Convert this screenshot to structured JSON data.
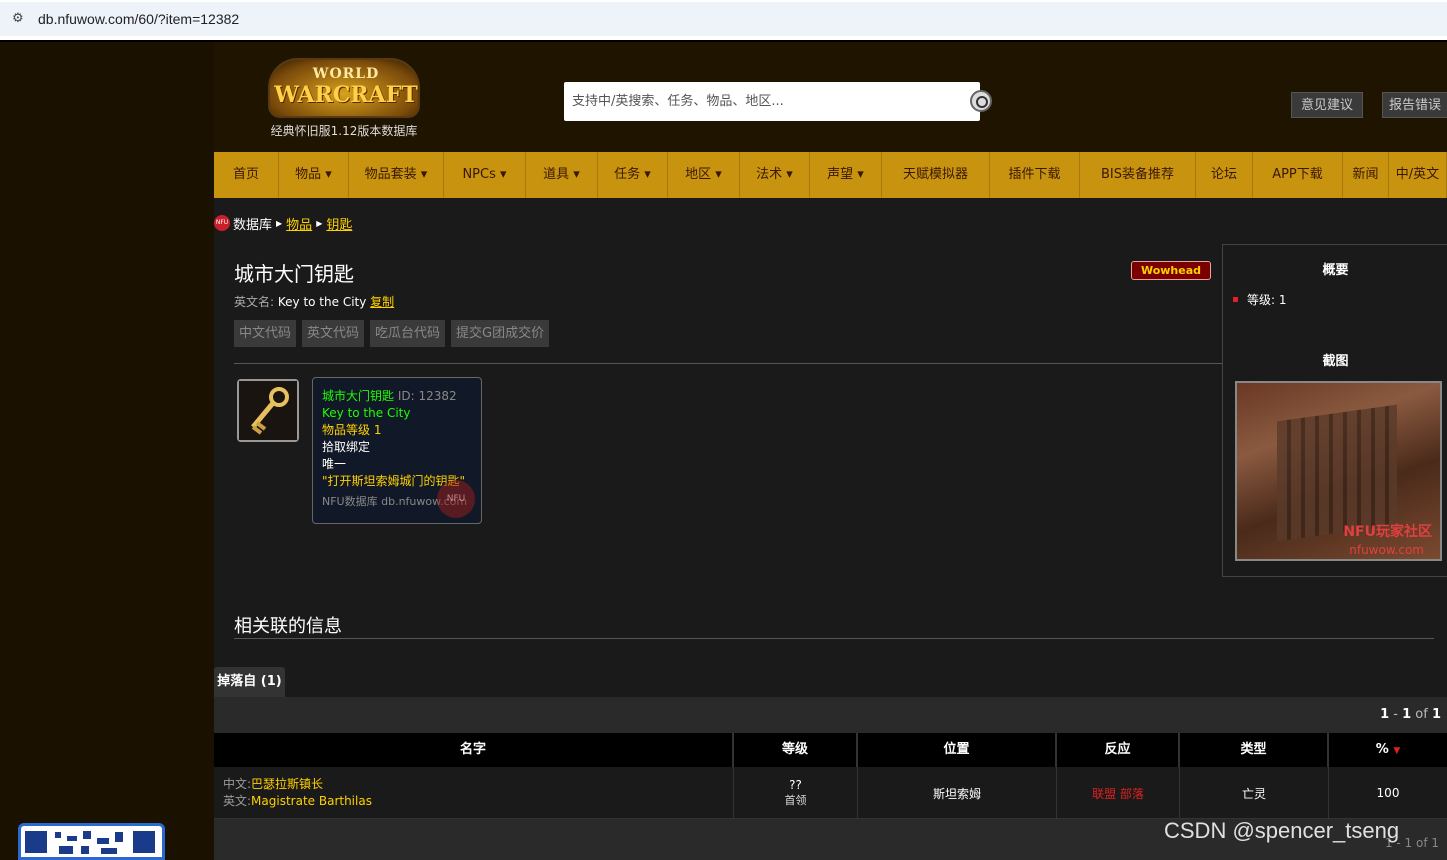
{
  "browser": {
    "url": "db.nfuwow.com/60/?item=12382"
  },
  "header": {
    "logo_line1": "WORLD",
    "logo_line2": "WARCRAFT",
    "logo_subtitle": "经典怀旧服1.12版本数据库",
    "search_placeholder": "支持中/英搜索、任务、物品、地区...",
    "feedback_button": "意见建议",
    "report_button": "报告错误"
  },
  "nav": {
    "items": [
      {
        "label": "首页",
        "dropdown": false
      },
      {
        "label": "物品",
        "dropdown": true
      },
      {
        "label": "物品套装",
        "dropdown": true
      },
      {
        "label": "NPCs",
        "dropdown": true
      },
      {
        "label": "道具",
        "dropdown": true
      },
      {
        "label": "任务",
        "dropdown": true
      },
      {
        "label": "地区",
        "dropdown": true
      },
      {
        "label": "法术",
        "dropdown": true
      },
      {
        "label": "声望",
        "dropdown": true
      },
      {
        "label": "天赋模拟器",
        "dropdown": false
      },
      {
        "label": "插件下载",
        "dropdown": false
      },
      {
        "label": "BIS装备推荐",
        "dropdown": false
      },
      {
        "label": "论坛",
        "dropdown": false
      },
      {
        "label": "APP下载",
        "dropdown": false
      },
      {
        "label": "新闻",
        "dropdown": false
      },
      {
        "label": "中/英文",
        "dropdown": false
      }
    ]
  },
  "breadcrumb": {
    "icon_text": "NFU",
    "root": "数据库",
    "level1": "物品",
    "level2": "钥匙"
  },
  "item": {
    "title": "城市大门钥匙",
    "wowhead_label": "Wowhead",
    "en_label": "英文名:",
    "en_name": "Key to the City",
    "copy_link": "复制",
    "code_buttons": [
      "中文代码",
      "英文代码",
      "吃瓜台代码",
      "提交G团成交价"
    ],
    "tooltip": {
      "name": "城市大门钥匙",
      "id": "ID: 12382",
      "en_name": "Key to the City",
      "item_level": "物品等级 1",
      "bind": "拾取绑定",
      "unique": "唯一",
      "description": "\"打开斯坦索姆城门的钥匙\"",
      "watermark": "NFU",
      "footer": "NFU数据库 db.nfuwow.com"
    }
  },
  "sidebar": {
    "summary_title": "概要",
    "summary_item": "等级: 1",
    "screenshot_title": "截图",
    "screenshot_watermark1": "NFU玩家社区",
    "screenshot_watermark2": "nfuwow.com"
  },
  "related": {
    "title": "相关联的信息",
    "tab_label": "掉落自 (1)",
    "pager_prefix": "1",
    "pager_mid": " - ",
    "pager_end": "1",
    "pager_of": " of ",
    "pager_total": "1",
    "columns": [
      "名字",
      "等级",
      "位置",
      "反应",
      "类型",
      "%"
    ],
    "rows": [
      {
        "cn_label": "中文:",
        "cn_name": "巴瑟拉斯镇长",
        "en_label": "英文:",
        "en_name": "Magistrate Barthilas",
        "level": "??",
        "level_sub": "首领",
        "location": "斯坦索姆",
        "react_alliance": "联盟",
        "react_horde": "部落",
        "type": "亡灵",
        "percent": "100"
      }
    ],
    "footer_pager": "1 - 1 of 1"
  },
  "watermark": "CSDN @spencer_tseng",
  "colors": {
    "nav_bg": "#c89410",
    "link_yellow": "#ffd100",
    "item_green": "#1eff00",
    "hostile_red": "#e02020"
  }
}
